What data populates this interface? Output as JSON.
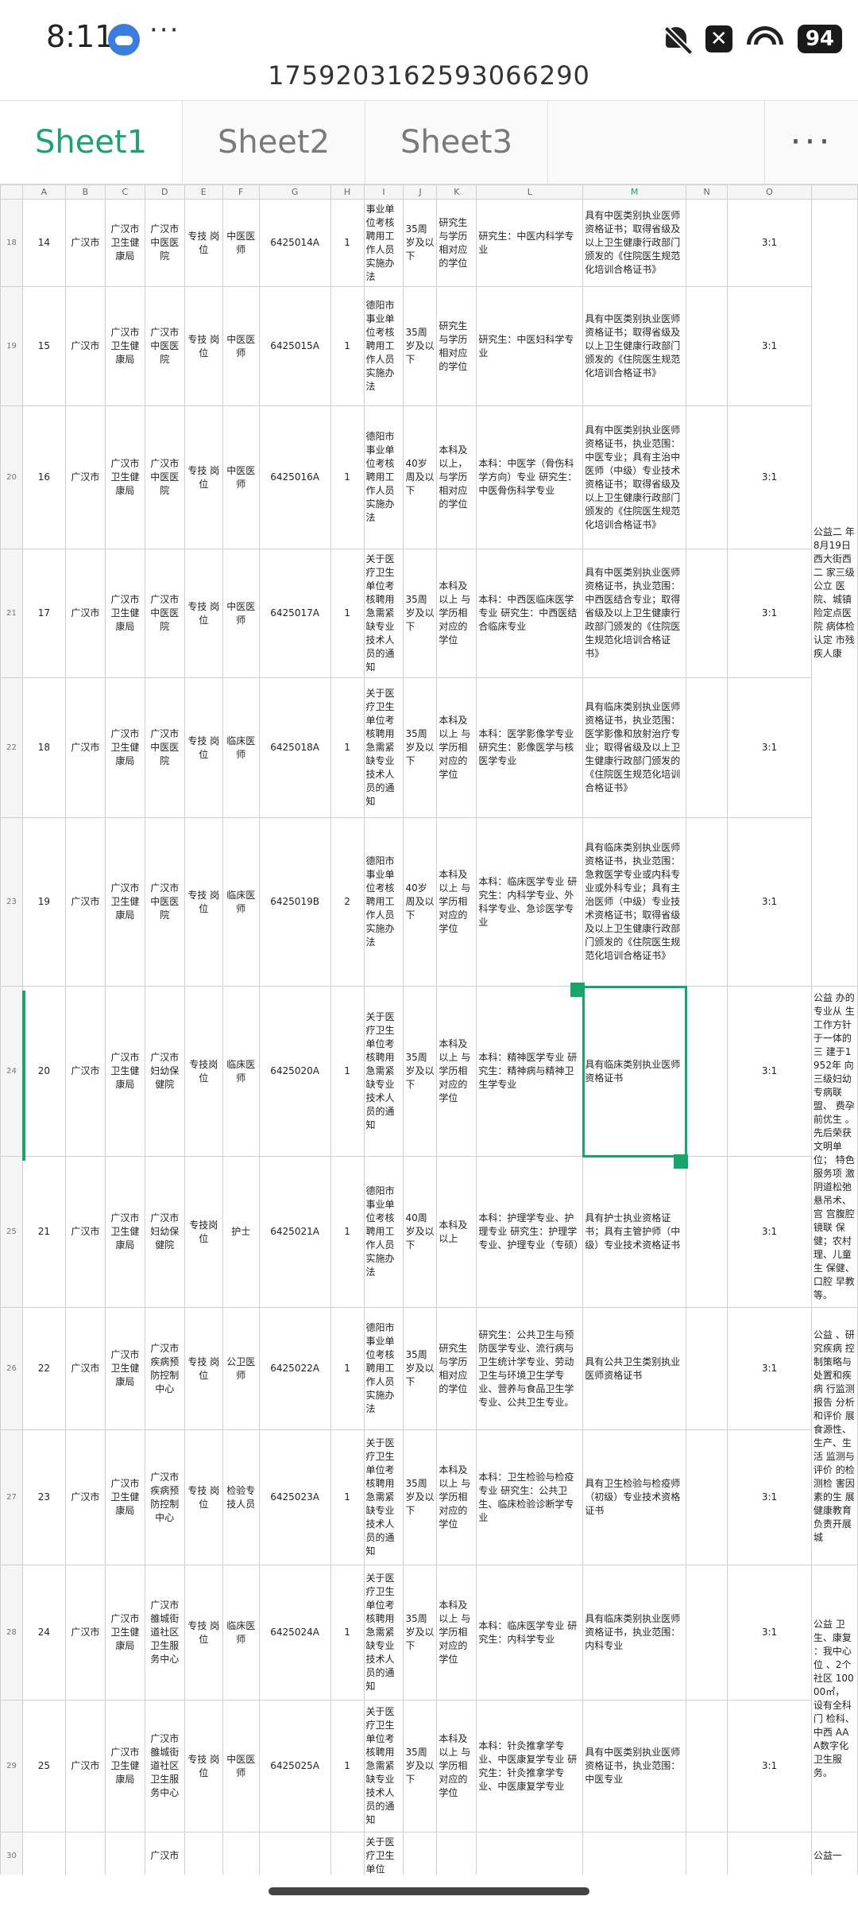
{
  "status_bar": {
    "time": "8:11",
    "more": "···",
    "battery": "94"
  },
  "file_name": "1759203162593066290",
  "tabs": [
    "Sheet1",
    "Sheet2",
    "Sheet3"
  ],
  "tabs_more": "···",
  "columns": [
    "A",
    "B",
    "C",
    "D",
    "E",
    "F",
    "G",
    "H",
    "I",
    "J",
    "K",
    "L",
    "M",
    "N",
    "O"
  ],
  "rows": [
    {
      "rn": "18",
      "a": "14",
      "b": "广汉市",
      "c": "广汉市卫生健康局",
      "d": "广汉市中医医院",
      "e": "专技 岗位",
      "f": "中医医师",
      "g": "6425014A",
      "h": "1",
      "i": "事业单位考核聘用工作人员实施办法",
      "j": "35周岁及以下",
      "k": "研究生与学历相对应的学位",
      "l": "研究生：中医内科学专业",
      "m": "具有中医类别执业医师资格证书；取得省级及以上卫生健康行政部门颁发的《住院医生规范化培训合格证书》",
      "n": "",
      "o": "3:1"
    },
    {
      "rn": "19",
      "a": "15",
      "b": "广汉市",
      "c": "广汉市卫生健康局",
      "d": "广汉市中医医院",
      "e": "专技 岗位",
      "f": "中医医师",
      "g": "6425015A",
      "h": "1",
      "i": "德阳市事业单位考核聘用工作人员实施办法",
      "j": "35周岁及以下",
      "k": "研究生与学历相对应的学位",
      "l": "研究生：中医妇科学专业",
      "m": "具有中医类别执业医师资格证书；取得省级及以上卫生健康行政部门颁发的《住院医生规范化培训合格证书》",
      "n": "",
      "o": "3:1"
    },
    {
      "rn": "20",
      "a": "16",
      "b": "广汉市",
      "c": "广汉市卫生健康局",
      "d": "广汉市中医医院",
      "e": "专技 岗位",
      "f": "中医医师",
      "g": "6425016A",
      "h": "1",
      "i": "德阳市事业单位考核聘用工作人员实施办法",
      "j": "40岁周及以下",
      "k": "本科及以上，与学历相对应的学位",
      "l": "本科：中医学（骨伤科学方向）专业 研究生：中医骨伤科学专业",
      "m": "具有中医类别执业医师资格证书，执业范围：中医专业；具有主治中医师（中级）专业技术资格证书；取得省级及以上卫生健康行政部门颁发的《住院医生规范化培训合格证书》",
      "n": "",
      "o": "3:1"
    },
    {
      "rn": "21",
      "a": "17",
      "b": "广汉市",
      "c": "广汉市卫生健康局",
      "d": "广汉市中医医院",
      "e": "专技 岗位",
      "f": "中医医师",
      "g": "6425017A",
      "h": "1",
      "i": "关于医疗卫生单位考核聘用急需紧缺专业技术人员的通知",
      "j": "35周岁及以下",
      "k": "本科及以上 与学历相对应的学位",
      "l": "本科：中西医临床医学专业 研究生：中西医结合临床专业",
      "m": "具有中医类别执业医师资格证书，执业范围：中西医结合专业；取得省级及以上卫生健康行政部门颁发的《住院医生规范化培训合格证书》",
      "n": "",
      "o": "3:1"
    },
    {
      "rn": "22",
      "a": "18",
      "b": "广汉市",
      "c": "广汉市卫生健康局",
      "d": "广汉市中医医院",
      "e": "专技 岗位",
      "f": "临床医师",
      "g": "6425018A",
      "h": "1",
      "i": "关于医疗卫生单位考核聘用急需紧缺专业技术人员的通知",
      "j": "35周岁及以下",
      "k": "本科及以上 与学历相对应的学位",
      "l": "本科：医学影像学专业 研究生：影像医学与核医学专业",
      "m": "具有临床类别执业医师资格证书，执业范围：医学影像和放射治疗专业；取得省级及以上卫生健康行政部门颁发的《住院医生规范化培训合格证书》",
      "n": "",
      "o": "3:1"
    },
    {
      "rn": "23",
      "a": "19",
      "b": "广汉市",
      "c": "广汉市卫生健康局",
      "d": "广汉市中医医院",
      "e": "专技 岗位",
      "f": "临床医师",
      "g": "6425019B",
      "h": "2",
      "i": "德阳市事业单位考核聘用工作人员实施办法",
      "j": "40岁周及以下",
      "k": "本科及以上 与学历相对应的学位",
      "l": "本科：临床医学专业 研究生：内科学专业、外科学专业、急诊医学专业",
      "m": "具有临床类别执业医师资格证书，执业范围：急救医学专业或内科专业或外科专业；具有主治医师（中级）专业技术资格证书；取得省级及以上卫生健康行政部门颁发的《住院医生规范化培训合格证书》",
      "n": "",
      "o": "3:1"
    },
    {
      "rn": "24",
      "a": "20",
      "b": "广汉市",
      "c": "广汉市卫生健康局",
      "d": "广汉市妇幼保健院",
      "e": "专技岗位",
      "f": "临床医师",
      "g": "6425020A",
      "h": "1",
      "i": "关于医疗卫生单位考核聘用急需紧缺专业技术人员的通知",
      "j": "35周岁及以下",
      "k": "本科及以上 与学历相对应的学位",
      "l": "本科：精神医学专业 研究生：精神病与精神卫生学专业",
      "m": "具有临床类别执业医师资格证书",
      "n": "",
      "o": "3:1"
    },
    {
      "rn": "25",
      "a": "21",
      "b": "广汉市",
      "c": "广汉市卫生健康局",
      "d": "广汉市妇幼保健院",
      "e": "专技岗位",
      "f": "护士",
      "g": "6425021A",
      "h": "1",
      "i": "德阳市事业单位考核聘用工作人员实施办法",
      "j": "40周岁及以下",
      "k": "本科及以上",
      "l": "本科：护理学专业、护理专业 研究生：护理学专业、护理专业（专硕）",
      "m": "具有护士执业资格证书；具有主管护师（中级）专业技术资格证书",
      "n": "",
      "o": "3:1"
    },
    {
      "rn": "26",
      "a": "22",
      "b": "广汉市",
      "c": "广汉市卫生健康局",
      "d": "广汉市疾病预防控制中心",
      "e": "专技 岗位",
      "f": "公卫医师",
      "g": "6425022A",
      "h": "1",
      "i": "德阳市事业单位考核聘用工作人员实施办法",
      "j": "35周岁及以下",
      "k": "研究生与学历相对应的学位",
      "l": "研究生：公共卫生与预防医学专业、流行病与卫生统计学专业、劳动卫生与环境卫生学专业、营养与食品卫生学专业、公共卫生专业。",
      "m": "具有公共卫生类别执业医师资格证书",
      "n": "",
      "o": "3:1"
    },
    {
      "rn": "27",
      "a": "23",
      "b": "广汉市",
      "c": "广汉市卫生健康局",
      "d": "广汉市疾病预防控制中心",
      "e": "专技 岗位",
      "f": "检验专技人员",
      "g": "6425023A",
      "h": "1",
      "i": "关于医疗卫生单位考核聘用急需紧缺专业技术人员的通知",
      "j": "35周岁及以下",
      "k": "本科及以上 与学历相对应的学位",
      "l": "本科：卫生检验与检疫专业 研究生：公共卫生、临床检验诊断学专业",
      "m": "具有卫生检验与检疫师（初级）专业技术资格证书",
      "n": "",
      "o": "3:1"
    },
    {
      "rn": "28",
      "a": "24",
      "b": "广汉市",
      "c": "广汉市卫生健康局",
      "d": "广汉市雒城街道社区卫生服务中心",
      "e": "专技 岗位",
      "f": "临床医师",
      "g": "6425024A",
      "h": "1",
      "i": "关于医疗卫生单位考核聘用急需紧缺专业技术人员的通知",
      "j": "35周岁及以下",
      "k": "本科及以上 与学历相对应的学位",
      "l": "本科：临床医学专业 研究生：内科学专业",
      "m": "具有临床类别执业医师资格证书，执业范围：内科专业",
      "n": "",
      "o": "3:1"
    },
    {
      "rn": "29",
      "a": "25",
      "b": "广汉市",
      "c": "广汉市卫生健康局",
      "d": "广汉市雒城街道社区卫生服务中心",
      "e": "专技 岗位",
      "f": "中医医师",
      "g": "6425025A",
      "h": "1",
      "i": "关于医疗卫生单位考核聘用急需紧缺专业技术人员的通知",
      "j": "35周岁及以下",
      "k": "本科及以上 与学历相对应的学位",
      "l": "本科：针灸推拿学专业、中医康复学专业 研究生：针灸推拿学专业、中医康复学专业",
      "m": "具有中医类别执业医师资格证书，执业范围：中医专业",
      "n": "",
      "o": "3:1"
    },
    {
      "rn": "30",
      "a": "",
      "b": "",
      "c": "",
      "d": "广汉市",
      "e": "",
      "f": "",
      "g": "",
      "h": "",
      "i": "关于医疗卫生单位",
      "j": "",
      "k": "",
      "l": "",
      "m": "",
      "n": "",
      "o": ""
    }
  ],
  "p_column_texts": [
    "公益二 年8月19日 西大街西二 家三级公立 医院、城镇 险定点医院 病体检认定 市残疾人康",
    "公益 办的专业从 生工作方针 于一体的三 建于1952年 向三级妇幼 专病联盟、 费孕前优生 。先后荣获 文明单位； 特色服务项 激阴道松弛 悬吊术、宫 宫腹腔镜联 保健；农村 理、儿童生 保健、口腔 早教等。",
    "公益 、研究疾病 控制策略与 处置和疾病 行监测报告 分析和评价 展食源性、 生产、生活 监测与评价 的检测检 害因素的生 展健康教育 负责开展城",
    "公益 卫生、康复 ：我中心位 、2个社区 10000㎡， 设有全科门 检科、中西 AAA数字化 卫生服务。",
    "公益一"
  ]
}
